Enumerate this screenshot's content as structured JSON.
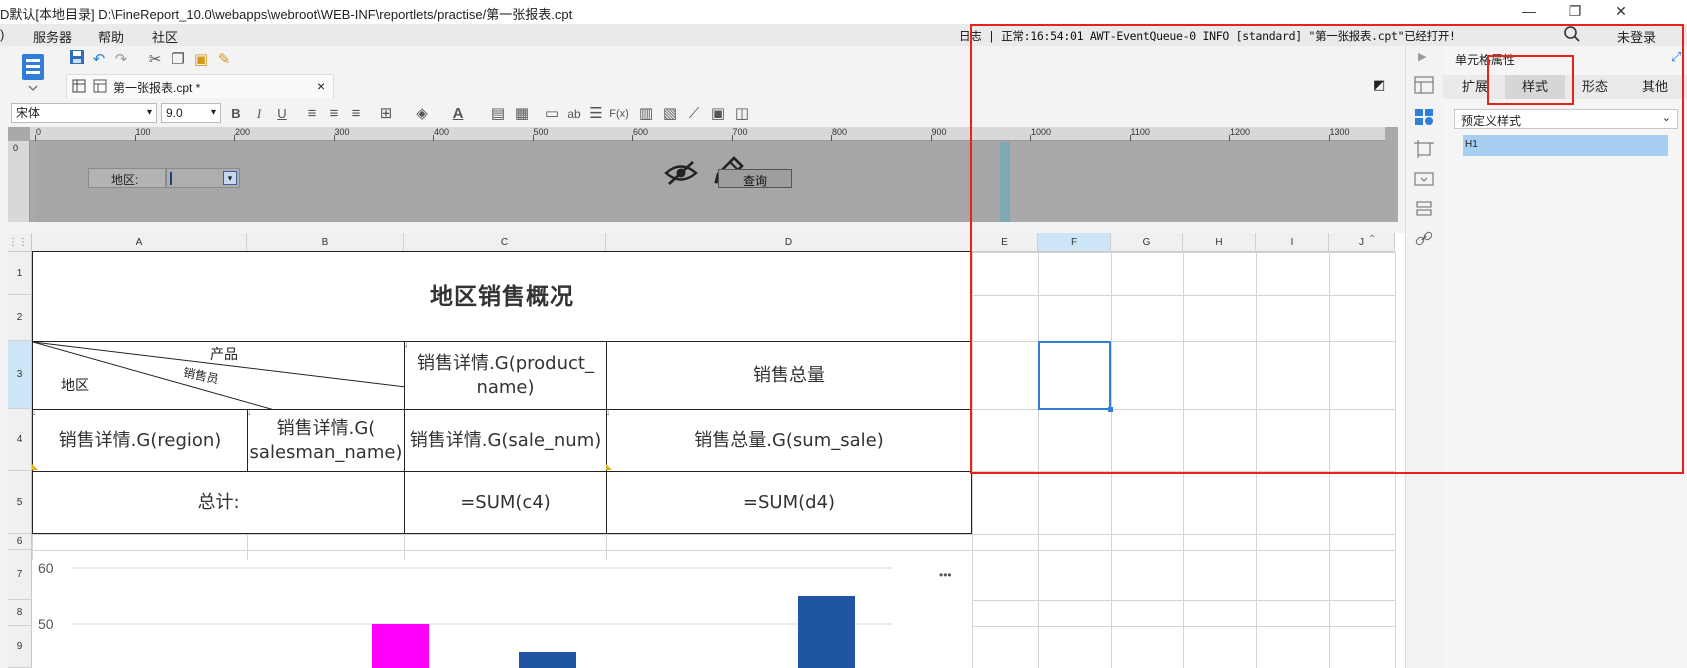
{
  "window": {
    "title": "D默认[本地目录]   D:\\FineReport_10.0\\webapps\\webroot\\WEB-INF\\reportlets/practise/第一张报表.cpt",
    "minimize": "—",
    "restore": "❐",
    "close": "✕"
  },
  "menubar": {
    "items": [
      "服务器",
      "帮助",
      "社区"
    ],
    "log_line": "日志 | 正常:16:54:01 AWT-EventQueue-0 INFO [standard] \"第一张报表.cpt\"已经打开!",
    "search_icon": "search-icon",
    "login_label": "未登录"
  },
  "tabs": {
    "active_label": "第一张报表.cpt *",
    "close": "×"
  },
  "format_bar": {
    "font_name": "宋体",
    "font_size": "9.0",
    "bold": "B",
    "italic": "I",
    "underline": "U",
    "formula": "F(x)",
    "ab": "ab"
  },
  "ruler": {
    "ticks": [
      "0",
      "100",
      "200",
      "300",
      "400",
      "500",
      "600",
      "700",
      "800",
      "900",
      "1000",
      "1100",
      "1200",
      "1300"
    ]
  },
  "param_panel": {
    "region_label": "地区:",
    "query_button": "查询"
  },
  "grid": {
    "columns": [
      "A",
      "B",
      "C",
      "D",
      "E",
      "F",
      "G",
      "H",
      "I",
      "J"
    ],
    "rows": [
      "1",
      "2",
      "3",
      "4",
      "5",
      "6",
      "7",
      "8",
      "9"
    ],
    "cells": {
      "title": "地区销售概况",
      "slash_product": "产品",
      "slash_salesman": "销售员",
      "slash_region": "地区",
      "c3": "销售详情.G(product_\nname)",
      "d3": "销售总量",
      "a4": "销售详情.G(region)",
      "b4": "销售详情.G(\nsalesman_name)",
      "c4": "销售详情.G(sale_num)",
      "d4": "销售总量.G(sum_sale)",
      "a5": "总计:",
      "c5": "=SUM(c4)",
      "d5": "=SUM(d4)"
    }
  },
  "chart_data": {
    "type": "bar",
    "ylim": [
      0,
      60
    ],
    "y_ticks": [
      "60",
      "50"
    ],
    "more_label": "•••",
    "bars": [
      {
        "value": 50,
        "color": "#ff00ff"
      },
      {
        "value": 45,
        "color": "#1f55a3"
      },
      {
        "value": 55,
        "color": "#1f55a3"
      }
    ]
  },
  "props_panel": {
    "title": "单元格属性",
    "tabs": [
      "扩展",
      "样式",
      "形态",
      "其他"
    ],
    "active_tab": "样式",
    "style_select": "预定义样式",
    "style_items": [
      "H1"
    ]
  },
  "colors": {
    "accent": "#2f7fd8",
    "highlight": "#e8211b",
    "selected_style": "#a6cff2"
  }
}
